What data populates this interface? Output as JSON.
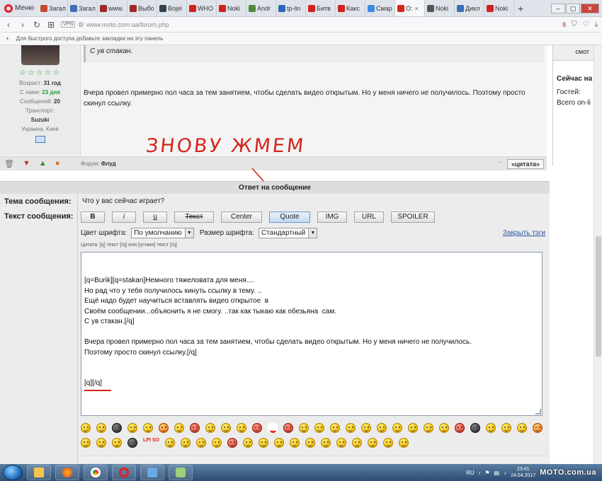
{
  "browser": {
    "menu_label": "Меню",
    "tabs": [
      {
        "label": "Загал",
        "color": "#c44a2c"
      },
      {
        "label": "Загал",
        "color": "#3d6fb6"
      },
      {
        "label": "www.",
        "color": "#a0282a"
      },
      {
        "label": "Выбо",
        "color": "#a0282a"
      },
      {
        "label": "Bojel",
        "color": "#33414f"
      },
      {
        "label": "WHO",
        "color": "#d02020"
      },
      {
        "label": "Noki",
        "color": "#d02020"
      },
      {
        "label": "Andr",
        "color": "#4d8a3a"
      },
      {
        "label": "tp-lin",
        "color": "#2a67b6"
      },
      {
        "label": "Битв",
        "color": "#d02020"
      },
      {
        "label": "Какс",
        "color": "#d02020"
      },
      {
        "label": "Смар",
        "color": "#3a8adf"
      },
      {
        "label": "О:",
        "color": "#d4251c",
        "active": true
      },
      {
        "label": "Noki",
        "color": "#555555"
      },
      {
        "label": "Дикл",
        "color": "#3d6fb6"
      },
      {
        "label": "Noki",
        "color": "#d02020"
      }
    ],
    "url": "www.moto.com.ua/forum.php",
    "vpn_label": "VPN",
    "badge_count": "8",
    "bookmarks_hint": "Для быстрого доступа добавьте закладки на эту панель"
  },
  "author": {
    "age_label": "Возраст:",
    "age_value": "31 год",
    "with_us_label": "С нами:",
    "with_us_value": "23 дня",
    "messages_label": "Сообщений:",
    "messages_value": "20",
    "transport_label": "Транспорт:",
    "transport_value": "Suzuki",
    "location": "Украина, Киев"
  },
  "post": {
    "quote_tail": "С ув стакан.",
    "text": "Вчера провел примерно пол часа за тем занятием, чтобы сделать видео открытым. Но у меня ничего не получилось. Поэтому просто скинул ссылку.",
    "forum_label": "Форум:",
    "forum_value": "Флуд",
    "quote_button": "«цитата»"
  },
  "sidebar": {
    "top_label": "смот",
    "title": "Сейчас на",
    "guests_label": "Гостей:",
    "online_label": "Всего on-li"
  },
  "annotation": "ЗНОВУ ЖМЕМ",
  "reply": {
    "header": "Ответ на сообщение",
    "subject_label": "Тема сообщения:",
    "subject_value": "Что у вас сейчас играет?",
    "text_label": "Текст сообщения:",
    "buttons": {
      "bold": "B",
      "italic": "i",
      "underline": "u",
      "strike": "Текст",
      "center": "Center",
      "quote": "Quote",
      "img": "IMG",
      "url": "URL",
      "spoiler": "SPOILER"
    },
    "font_color_label": "Цвет шрифта:",
    "font_color_value": "По умолчанию",
    "font_size_label": "Размер шрифта:",
    "font_size_value": "Стандартный",
    "close_tags": "Закрыть тэги",
    "hint": "Цитата: [q] текст [/q] или [q=имя] текст [/q]",
    "lines": [
      "[q=Burik][q=stakan]Немного тяжеловата для меня....",
      "Но рад что у тебя получилось кинуть ссылку в тему. ..",
      "Ещё надо будет научиться вставлять видео открытое  в",
      "Своём сообщении...объяснить я не смогу. ..так как тыкаю как обезьяна  сам.",
      "С ув стакан.[/q]",
      "",
      "Вчера провел примерно пол часа за тем занятием, чтобы сделать видео открытым. Но у меня ничего не получилось.",
      "Поэтому просто скинул ссылку.[/q]",
      "",
      "",
      "[q][/q]"
    ],
    "smiley_badge": "LPI SO"
  },
  "taskbar": {
    "lang": "RU",
    "time": "23:41",
    "date": "24.04.2017",
    "watermark": "MOTO.com.ua"
  }
}
